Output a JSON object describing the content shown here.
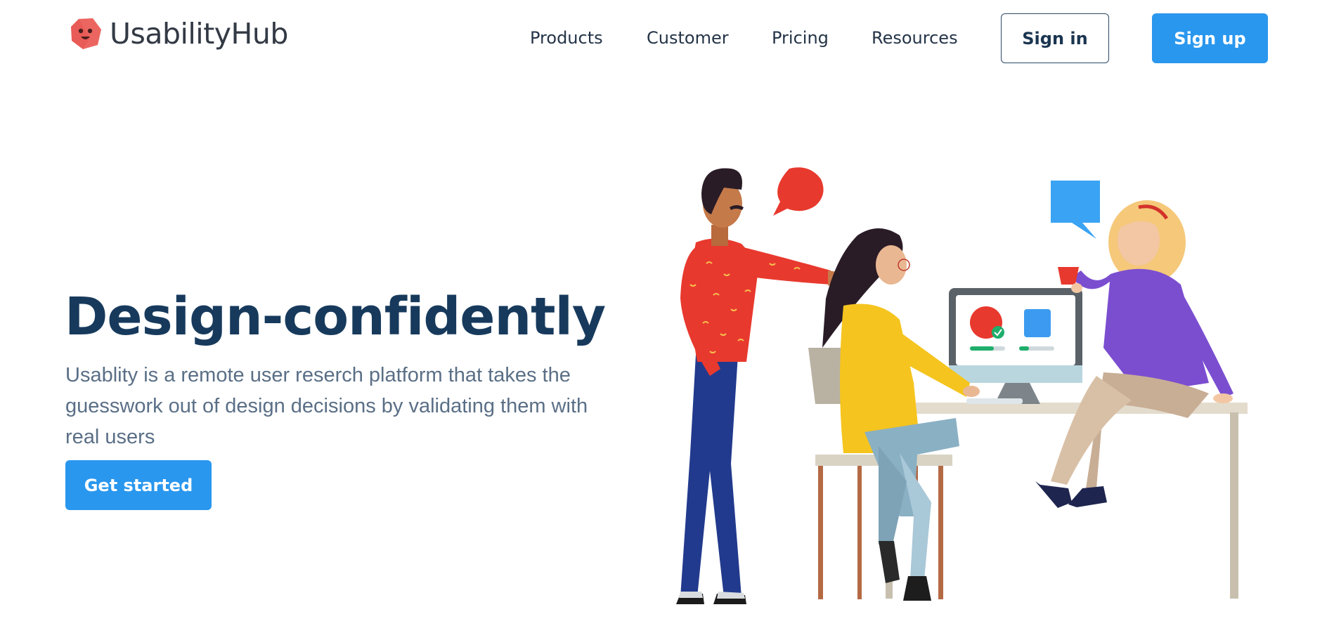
{
  "brand": {
    "name": "UsabilityHub",
    "logo_icon": "hexagon-face-logo-icon",
    "logo_color": "#e95b56"
  },
  "nav": {
    "links": [
      "Products",
      "Customer",
      "Pricing",
      "Resources"
    ],
    "sign_in": "Sign in",
    "sign_up": "Sign up"
  },
  "hero": {
    "title": "Design-confidently",
    "subtitle": "Usablity is a remote user reserch platform that takes the guesswork out of design decisions by validating them with real users",
    "cta": "Get started",
    "illustration": "team-collaboration-illustration"
  },
  "colors": {
    "primary": "#2a97ee",
    "heading": "#173a5c",
    "body_text": "#5a6f86"
  }
}
